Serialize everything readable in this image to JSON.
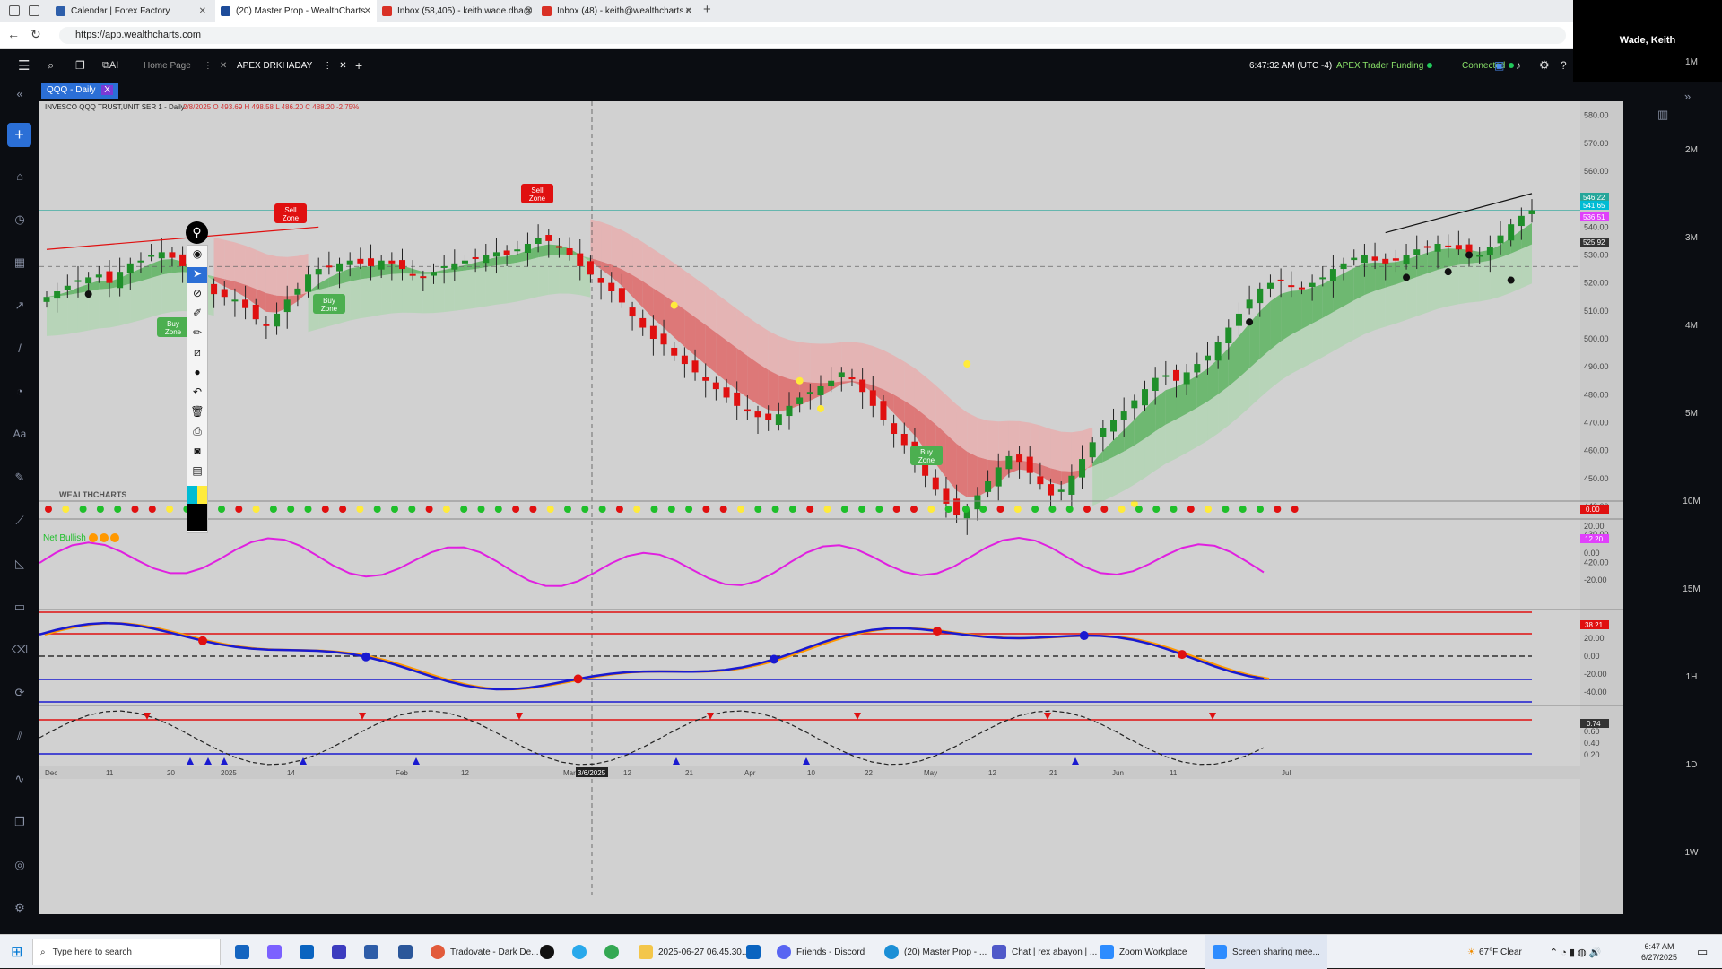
{
  "browser": {
    "tabs": [
      {
        "title": "Calendar | Forex Factory",
        "color": "#2d5eaa"
      },
      {
        "title": "(20) Master Prop - WealthCharts",
        "color": "#1e4c9a"
      },
      {
        "title": "Inbox (58,405) - keith.wade.dba@",
        "color": "#d93025"
      },
      {
        "title": "Inbox (48) - keith@wealthcharts.c",
        "color": "#d93025"
      }
    ],
    "url": "https://app.wealthcharts.com",
    "user": "Wade, Keith"
  },
  "app": {
    "tabs": [
      {
        "label": "Home Page"
      },
      {
        "label": "APEX DRKHADAY"
      }
    ],
    "time": "6:47:32 AM  (UTC -4)",
    "funding": "APEX Trader Funding",
    "status": "Connected",
    "chart_tab": "QQQ - Daily"
  },
  "legend": {
    "symbol": "INVESCO QQQ TRUST,UNIT SER 1 - Daily",
    "ohlc": "2/8/2025  O 493.69  H 498.58  L 486.20  C 488.20  -2.75%"
  },
  "watermark": "WEALTHCHARTS",
  "net_label": "Net Bullish",
  "annotations": {
    "sell": "Sell Zone",
    "buy": "Buy Zone"
  },
  "axis": {
    "price_ticks": [
      "580.00",
      "570.00",
      "560.00",
      "550.00",
      "540.00",
      "530.00",
      "520.00",
      "510.00",
      "500.00",
      "490.00",
      "480.00",
      "470.00",
      "460.00",
      "450.00",
      "440.00",
      "430.00",
      "420.00"
    ],
    "price_tags": [
      {
        "text": "546.22",
        "color": "#26a69a"
      },
      {
        "text": "541.65",
        "color": "#00bcd4"
      },
      {
        "text": "536.51",
        "color": "#e040fb"
      },
      {
        "text": "525.92",
        "color": "#333333"
      }
    ],
    "dot_tag": "0.00",
    "osc1_ticks": [
      "20.00",
      "0.00",
      "-20.00"
    ],
    "osc1_tag": "12.20",
    "osc2_ticks": [
      "20.00",
      "0.00",
      "-20.00",
      "-40.00"
    ],
    "osc2_tag": "38.21",
    "osc3_ticks": [
      "0.60",
      "0.40",
      "0.20"
    ],
    "osc3_tag": "0.74",
    "date_ticks": [
      "Dec",
      "11",
      "20",
      "2025",
      "14",
      "Feb",
      "12",
      "Mar",
      "12",
      "21",
      "Apr",
      "10",
      "22",
      "May",
      "12",
      "21",
      "Jun",
      "11",
      "Jul"
    ],
    "cursor_date": "3/6/2025"
  },
  "timeframes": [
    "1M",
    "2M",
    "3M",
    "4M",
    "5M",
    "10M",
    "15M",
    "1H",
    "1D",
    "1W"
  ],
  "taskbar": {
    "search_placeholder": "Type here to search",
    "items": [
      {
        "label": "Tradovate - Dark De..."
      },
      {
        "label": "2025-06-27 06.45.30..."
      },
      {
        "label": "Friends - Discord"
      },
      {
        "label": "(20) Master Prop - ..."
      },
      {
        "label": "Chat | rex abayon | ..."
      },
      {
        "label": "Zoom Workplace"
      },
      {
        "label": "Screen sharing mee..."
      }
    ],
    "weather": "67°F  Clear",
    "clock_time": "6:47 AM",
    "clock_date": "6/27/2025"
  },
  "chart_data": {
    "type": "candlestick",
    "ylim": [
      415,
      585
    ],
    "closes": [
      515,
      517,
      519,
      521,
      522,
      523,
      520,
      524,
      527,
      528,
      530,
      531,
      529,
      526,
      522,
      519,
      516,
      515,
      514,
      511,
      507,
      505,
      509,
      514,
      518,
      523,
      525,
      526,
      527,
      528,
      527,
      526,
      528,
      527,
      525,
      523,
      522,
      524,
      526,
      527,
      528,
      529,
      530,
      531,
      530,
      532,
      534,
      536,
      535,
      533,
      530,
      526,
      523,
      520,
      517,
      513,
      508,
      504,
      500,
      498,
      494,
      491,
      488,
      485,
      482,
      479,
      476,
      474,
      472,
      471,
      473,
      476,
      479,
      481,
      483,
      485,
      488,
      486,
      481,
      476,
      471,
      466,
      462,
      458,
      451,
      446,
      441,
      437,
      439,
      444,
      449,
      454,
      458,
      456,
      452,
      448,
      444,
      446,
      451,
      457,
      463,
      468,
      471,
      474,
      478,
      482,
      486,
      487,
      485,
      488,
      491,
      494,
      499,
      504,
      509,
      514,
      518,
      520,
      521,
      519,
      518,
      520,
      522,
      525,
      527,
      529,
      530,
      528,
      527,
      528,
      530,
      532,
      533,
      534,
      533,
      532,
      531,
      530,
      533,
      537,
      541,
      544,
      546
    ]
  }
}
